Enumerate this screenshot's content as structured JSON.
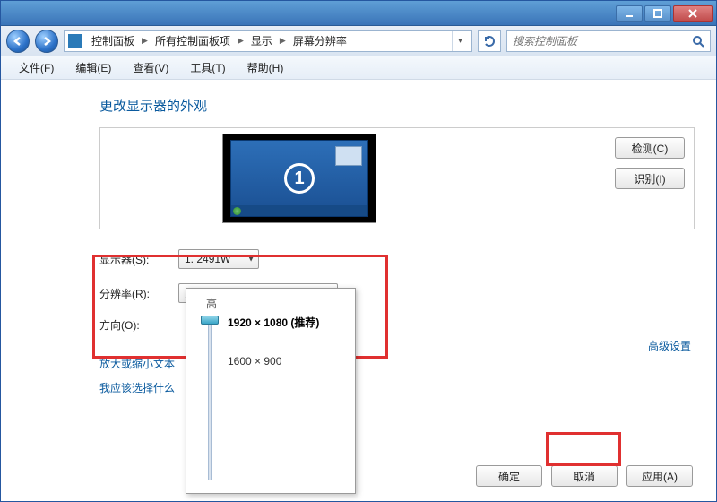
{
  "window": {
    "breadcrumbs": [
      "控制面板",
      "所有控制面板项",
      "显示",
      "屏幕分辨率"
    ],
    "search_placeholder": "搜索控制面板"
  },
  "menu": {
    "file": "文件(F)",
    "edit": "编辑(E)",
    "view": "查看(V)",
    "tools": "工具(T)",
    "help": "帮助(H)"
  },
  "page": {
    "title": "更改显示器的外观",
    "monitor_number": "1",
    "detect_btn": "检测(C)",
    "identify_btn": "识别(I)",
    "monitor_label": "显示器(S):",
    "monitor_value": "1. 2491W",
    "resolution_label": "分辨率(R):",
    "resolution_value": "1920 × 1080 (推荐)",
    "orientation_label": "方向(O):",
    "dropdown_top": "高",
    "dropdown_recommended": "1920 × 1080 (推荐)",
    "dropdown_mid": "1600 × 900",
    "zoom_link": "放大或缩小文本",
    "which_link": "我应该选择什么",
    "advanced_link": "高级设置",
    "ok_btn": "确定",
    "cancel_btn": "取消",
    "apply_btn": "应用(A)"
  }
}
